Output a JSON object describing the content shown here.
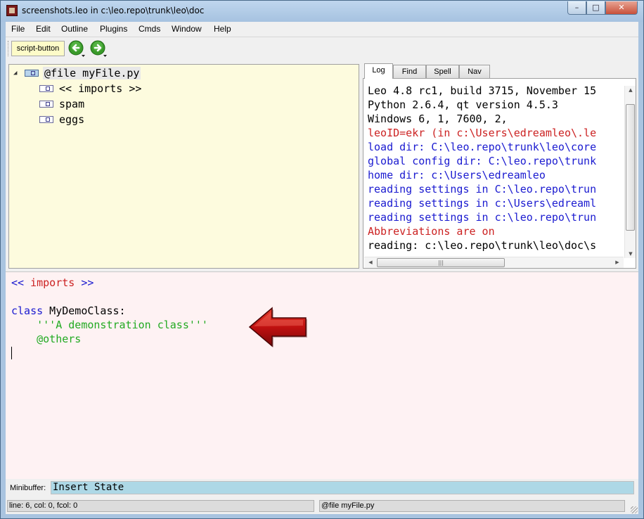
{
  "window": {
    "title": "screenshots.leo in c:\\leo.repo\\trunk\\leo\\doc",
    "minimize_glyph": "–",
    "maximize_glyph": "□",
    "close_glyph": "✕"
  },
  "menu": [
    "File",
    "Edit",
    "Outline",
    "Plugins",
    "Cmds",
    "Window",
    "Help"
  ],
  "toolbar": {
    "script_button": "script-button",
    "back_icon": "green-back-arrow-icon",
    "forward_icon": "green-forward-arrow-icon"
  },
  "outline": {
    "nodes": [
      {
        "label": "@file myFile.py",
        "level": 0,
        "expanded": true,
        "selected": true
      },
      {
        "label": "<< imports >>",
        "level": 1
      },
      {
        "label": "spam",
        "level": 1
      },
      {
        "label": "eggs",
        "level": 1
      }
    ]
  },
  "log_tabs": [
    "Log",
    "Find",
    "Spell",
    "Nav"
  ],
  "log": {
    "lines": [
      {
        "text": "Leo 4.8 rc1, build 3715, November 15",
        "color": "#000000"
      },
      {
        "text": "Python 2.6.4, qt version 4.5.3",
        "color": "#000000"
      },
      {
        "text": "Windows 6, 1, 7600, 2,",
        "color": "#000000"
      },
      {
        "text": "leoID=ekr (in c:\\Users\\edreamleo\\.le",
        "color": "#cc2222"
      },
      {
        "text": "load dir: C:\\leo.repo\\trunk\\leo\\core",
        "color": "#1a1ad0"
      },
      {
        "text": "global config dir: C:\\leo.repo\\trunk",
        "color": "#1a1ad0"
      },
      {
        "text": "home dir: c:\\Users\\edreamleo",
        "color": "#1a1ad0"
      },
      {
        "text": "reading settings in C:\\leo.repo\\trun",
        "color": "#1a1ad0"
      },
      {
        "text": "reading settings in c:\\Users\\edreaml",
        "color": "#1a1ad0"
      },
      {
        "text": "reading settings in c:\\leo.repo\\trun",
        "color": "#1a1ad0"
      },
      {
        "text": "Abbreviations are on",
        "color": "#cc2222"
      },
      {
        "text": "reading: c:\\leo.repo\\trunk\\leo\\doc\\s",
        "color": "#000000"
      }
    ]
  },
  "body": {
    "line1": {
      "open": "<<",
      "name": " imports ",
      "close": ">>"
    },
    "line3": {
      "keyword": "class",
      "rest": " MyDemoClass:"
    },
    "line4": "    '''A demonstration class'''",
    "line5": "    @others",
    "colors": {
      "delim": "#1a1ad0",
      "section": "#cc2222",
      "keyword": "#1a1ad0",
      "docstring": "#22aa22",
      "directive": "#22aa22"
    }
  },
  "minibuffer": {
    "label": "Minibuffer:",
    "value": "Insert State"
  },
  "status": {
    "position": "line: 6, col: 0, fcol: 0",
    "node": "@file myFile.py"
  },
  "colors": {
    "outline_bg": "#fdfbde",
    "body_bg": "#fef2f3",
    "minibuffer_bg": "#add8e6",
    "arrow_red": "#c81414"
  }
}
